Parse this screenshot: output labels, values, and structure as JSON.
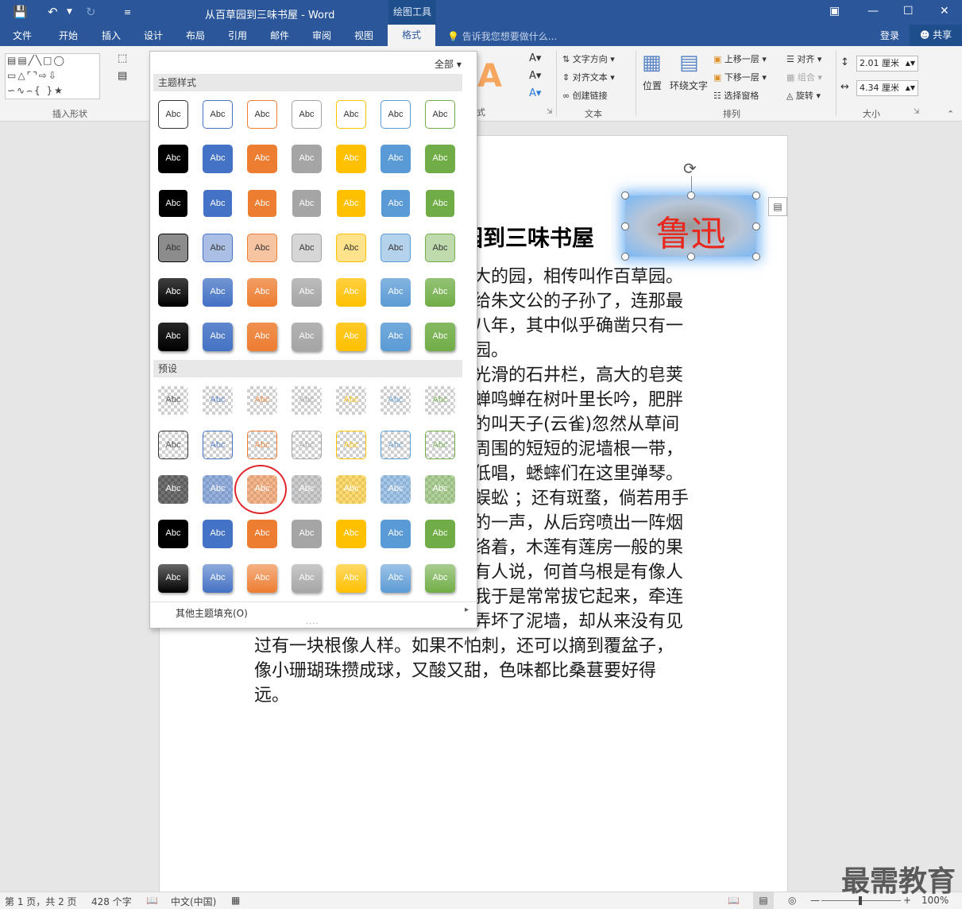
{
  "title_bar": {
    "doc_title": "从百草园到三味书屋 - Word",
    "context_tab_title": "绘图工具",
    "save_icon": "save-icon",
    "undo_icon": "undo-icon",
    "redo_icon": "redo-icon"
  },
  "tabs": {
    "items": [
      "文件",
      "开始",
      "插入",
      "设计",
      "布局",
      "引用",
      "邮件",
      "审阅",
      "视图"
    ],
    "active": "格式",
    "tell_me": "告诉我您想要做什么...",
    "login": "登录",
    "share": "共享"
  },
  "ribbon": {
    "insert_shapes_label": "插入形状",
    "text_group_label": "文本",
    "arrange_group_label": "排列",
    "size_group_label": "大小",
    "text_direction": "文字方向",
    "align_text": "对齐文本",
    "create_link": "创建链接",
    "position": "位置",
    "wrap_text": "环绕文字",
    "bring_forward": "上移一层",
    "send_backward": "下移一层",
    "selection_pane": "选择窗格",
    "align": "对齐",
    "group": "组合",
    "rotate": "旋转",
    "height": "2.01 厘米",
    "width": "4.34 厘米",
    "partial_label": "式"
  },
  "gallery": {
    "filter": "全部",
    "theme_section": "主题样式",
    "preset_section": "预设",
    "swatch_text": "Abc",
    "more_fills": "其他主题填充(O)",
    "grip": "....",
    "colors": [
      "#000000",
      "#4472c4",
      "#ed7d31",
      "#a5a5a5",
      "#ffc000",
      "#5b9bd5",
      "#70ad47"
    ]
  },
  "document": {
    "heading": "园到三味书屋",
    "wordart": "鲁迅",
    "lines": [
      "大的园，相传叫作百草园。",
      "给朱文公的子孙了，连那最",
      "八年，其中似乎确凿只有一",
      "园。",
      "光滑的石井栏，高大的皂荚",
      "蝉鸣蝉在树叶里长吟，肥胖",
      "的叫天子(云雀)忽然从草间",
      "周围的短短的泥墙根一带，",
      "低唱，蟋蟀们在这里弹琴。",
      "蜈蚣 ；还有斑蝥，倘若用手",
      "的一声，从后窍喷出一阵烟",
      "络着，木莲有莲房一般的果",
      "有人说，何首乌根是有像人",
      "我于是常常拔它起来，牵连",
      "弄坏了泥墙，却从来没有见",
      "过有一块根像人样。如果不怕刺，还可以摘到覆盆子，",
      "像小珊瑚珠攒成球，又酸又甜，色味都比桑葚要好得",
      "远。"
    ]
  },
  "status": {
    "page": "第 1 页，共 2 页",
    "words": "428 个字",
    "language": "中文(中国)",
    "zoom": "100%"
  },
  "watermark": "最需教育"
}
